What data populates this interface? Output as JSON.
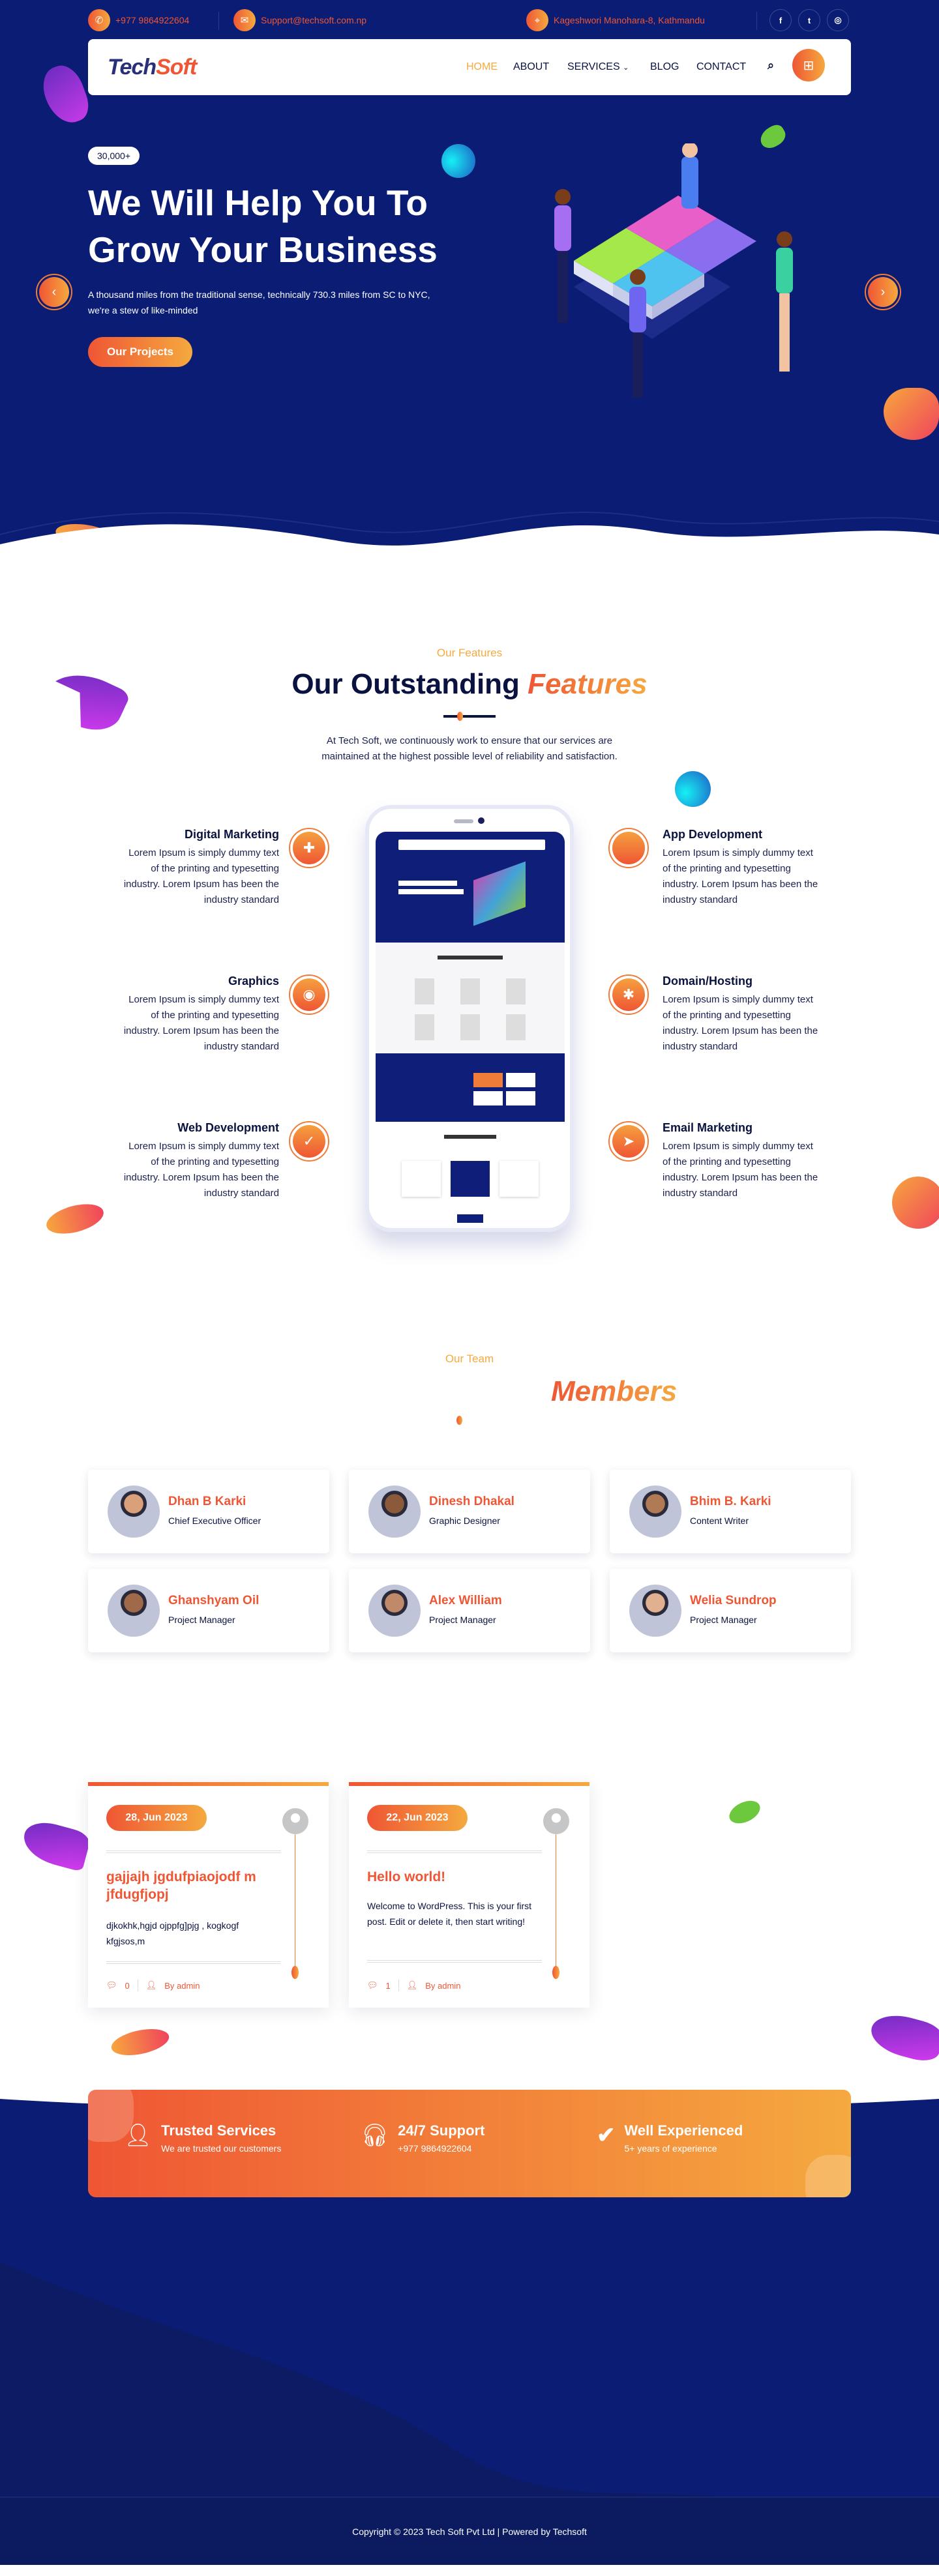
{
  "topbar": {
    "phone": "+977 9864922604",
    "email": "Support@techsoft.com.np",
    "address": "Kageshwori Manohara-8, Kathmandu",
    "social": [
      {
        "icon": "facebook-icon",
        "glyph": "f"
      },
      {
        "icon": "twitter-icon",
        "glyph": "t"
      },
      {
        "icon": "instagram-icon",
        "glyph": "◎"
      }
    ]
  },
  "nav": {
    "logo_part1": "Tech",
    "logo_part2": "Soft",
    "items": [
      "HOME",
      "ABOUT",
      "SERVICES",
      "BLOG",
      "CONTACT"
    ],
    "active": "HOME"
  },
  "hero": {
    "badge": "30,000+",
    "title_line1": "We Will Help You To",
    "title_line2": "Grow Your Business",
    "description_line1": "A thousand miles from the traditional sense, technically 730.3 miles from SC to NYC,",
    "description_line2": "we're a stew of like-minded",
    "cta": "Our Projects"
  },
  "features": {
    "eyebrow": "Our Features",
    "title_main": "Our Outstanding",
    "title_accent": "Features",
    "intro_line1": "At Tech Soft, we continuously work to ensure that our services are",
    "intro_line2": "maintained at the highest possible level of reliability and satisfaction.",
    "items": [
      {
        "title": "Digital Marketing",
        "icon": "puzzle-icon",
        "lines": [
          "Lorem Ipsum is simply dummy text",
          "of the printing and typesetting",
          "industry. Lorem Ipsum has been the",
          "industry standard"
        ]
      },
      {
        "title": "App Development",
        "icon": "apple-icon",
        "lines": [
          "Lorem Ipsum is simply dummy text",
          "of the printing and typesetting",
          "industry. Lorem Ipsum has been the",
          "industry standard"
        ]
      },
      {
        "title": "Graphics",
        "icon": "camera-icon",
        "lines": [
          "Lorem Ipsum is simply dummy text",
          "of the printing and typesetting",
          "industry. Lorem Ipsum has been the",
          "industry standard"
        ]
      },
      {
        "title": "Domain/Hosting",
        "icon": "asterisk-icon",
        "lines": [
          "Lorem Ipsum is simply dummy text",
          "of the printing and typesetting",
          "industry. Lorem Ipsum has been the",
          "industry standard"
        ]
      },
      {
        "title": "Web Development",
        "icon": "check-icon",
        "lines": [
          "Lorem Ipsum is simply dummy text",
          "of the printing and typesetting",
          "industry. Lorem Ipsum has been the",
          "industry standard"
        ]
      },
      {
        "title": "Email Marketing",
        "icon": "paper-plane-icon",
        "lines": [
          "Lorem Ipsum is simply dummy text",
          "of the printing and typesetting",
          "industry. Lorem Ipsum has been the",
          "industry standard"
        ]
      }
    ]
  },
  "team": {
    "eyebrow": "Our Team",
    "title_accent": "Members",
    "members": [
      {
        "name": "Dhan B Karki",
        "role": "Chief Executive Officer"
      },
      {
        "name": "Dinesh Dhakal",
        "role": "Graphic Designer"
      },
      {
        "name": "Bhim B. Karki",
        "role": "Content Writer"
      },
      {
        "name": "Ghanshyam Oil",
        "role": "Project Manager"
      },
      {
        "name": "Alex William",
        "role": "Project Manager"
      },
      {
        "name": "Welia Sundrop",
        "role": "Project Manager"
      }
    ]
  },
  "blog": {
    "posts": [
      {
        "date": "28, Jun 2023",
        "title": "gajjajh jgdufpiaojodf m jfdugfjopj",
        "excerpt": "djkokhk,hgjd ojppfg]pjg , kogkogf kfgjsos,m",
        "comments": "0",
        "author": "By admin"
      },
      {
        "date": "22, Jun 2023",
        "title": "Hello world!",
        "excerpt": "Welcome to WordPress. This is your first post. Edit or delete it, then start writing!",
        "comments": "1",
        "author": "By admin"
      }
    ]
  },
  "cta": {
    "items": [
      {
        "icon": "user-icon",
        "title": "Trusted Services",
        "subtitle": "We are trusted our customers"
      },
      {
        "icon": "headset-icon",
        "title": "24/7 Support",
        "subtitle": "+977 9864922604"
      },
      {
        "icon": "check-icon",
        "title": "Well Experienced",
        "subtitle": "5+ years of experience"
      }
    ]
  },
  "footer": {
    "copyright": "Copyright © 2023 Tech Soft Pvt Ltd | Powered by Techsoft"
  },
  "colors": {
    "navy": "#0a1c74",
    "accent_start": "#ef5634",
    "accent_end": "#f5a93f",
    "footer": "#0c1b60"
  }
}
